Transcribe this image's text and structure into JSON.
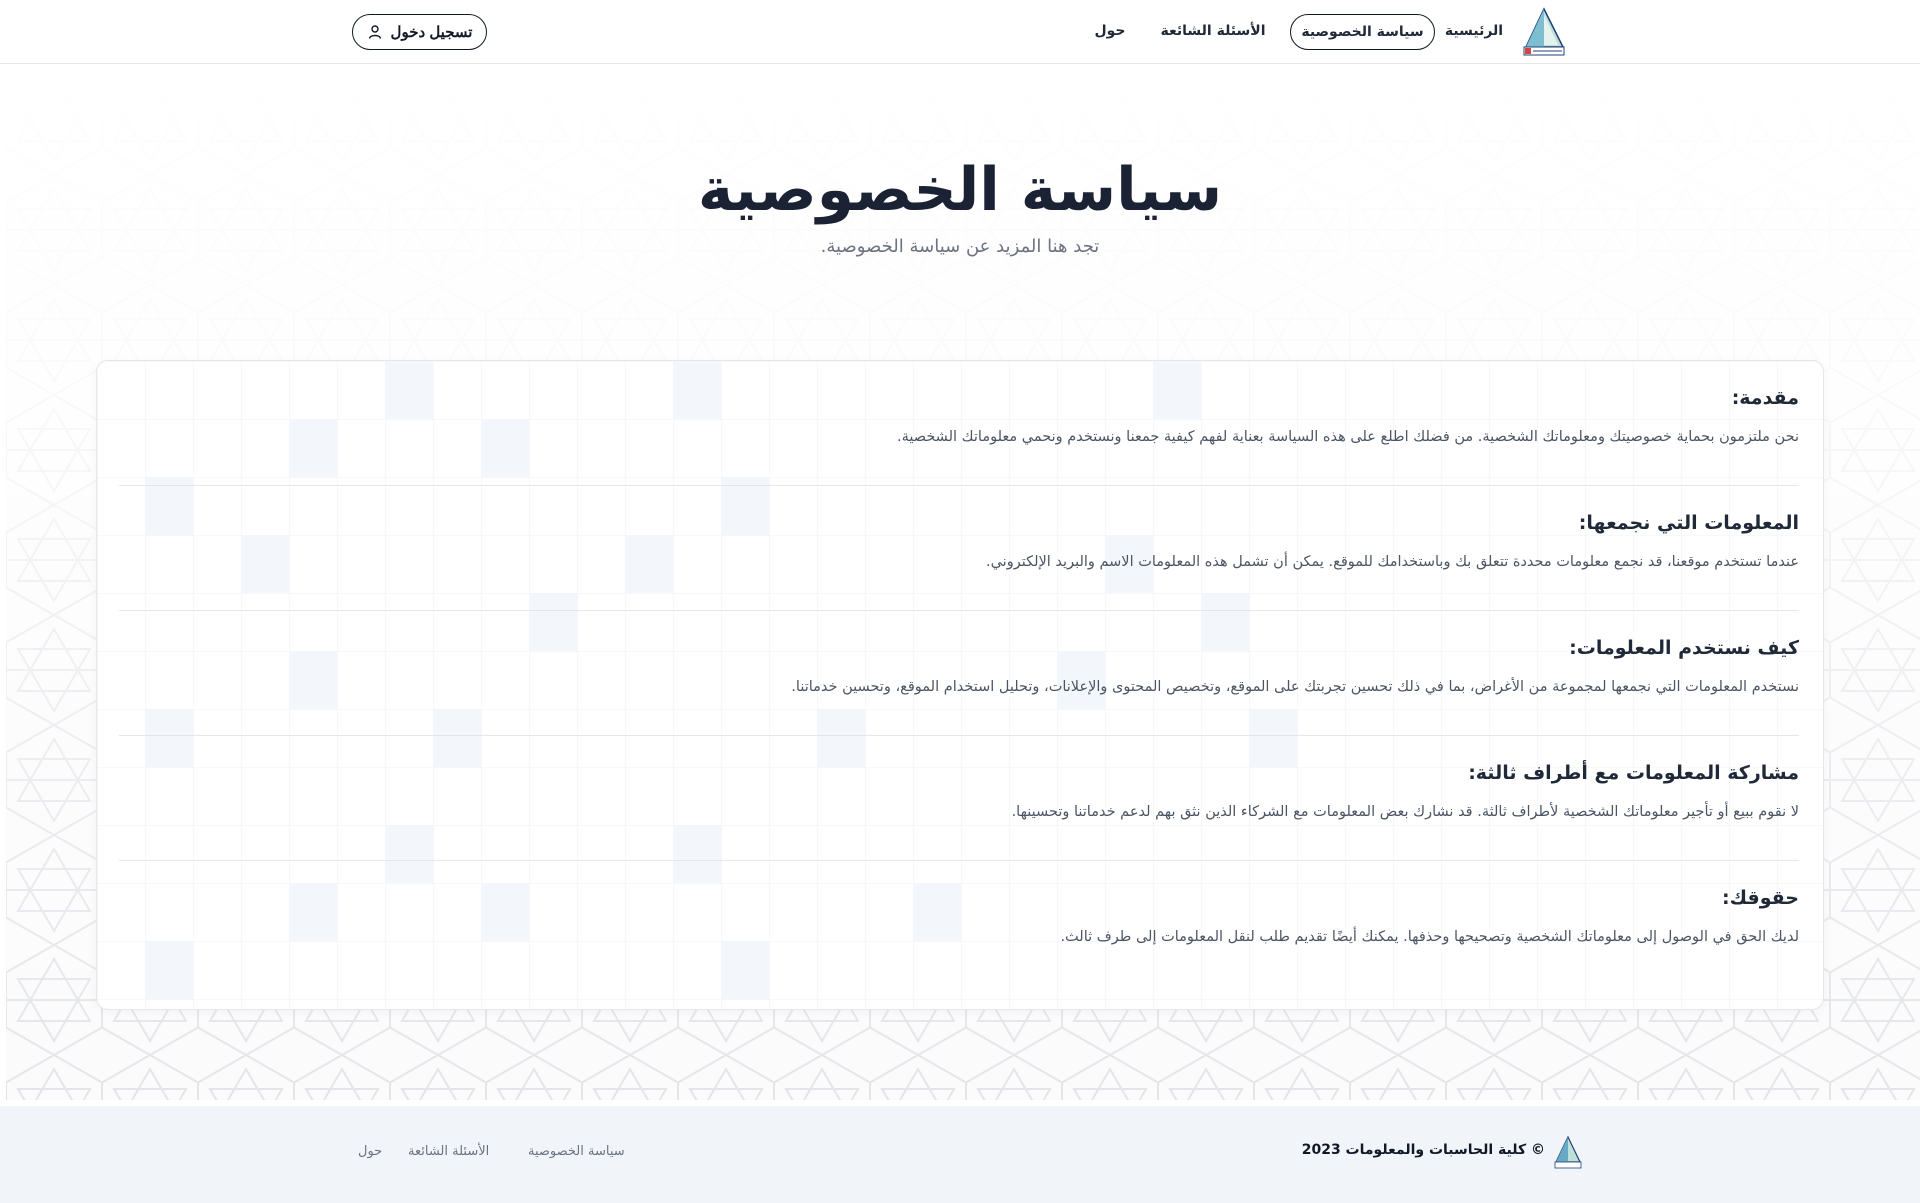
{
  "header": {
    "logo": "college-sailboat-logo",
    "nav": {
      "home": "الرئيسية",
      "privacy": "سياسة الخصوصية",
      "faq": "الأسئلة الشائعة",
      "about": "حول"
    },
    "login_label": "تسجيل دخول",
    "login_icon": "user-icon"
  },
  "hero": {
    "title": "سياسة الخصوصية",
    "subtitle": "تجد هنا المزيد عن سياسة الخصوصية."
  },
  "sections": [
    {
      "title": "مقدمة:",
      "body": "نحن ملتزمون بحماية خصوصيتك ومعلوماتك الشخصية. من فضلك اطلع على هذه السياسة بعناية لفهم كيفية جمعنا ونستخدم ونحمي معلوماتك الشخصية."
    },
    {
      "title": "المعلومات التي نجمعها:",
      "body": "عندما تستخدم موقعنا، قد نجمع معلومات محددة تتعلق بك وباستخدامك للموقع. يمكن أن تشمل هذه المعلومات الاسم والبريد الإلكتروني."
    },
    {
      "title": "كيف نستخدم المعلومات:",
      "body": "نستخدم المعلومات التي نجمعها لمجموعة من الأغراض، بما في ذلك تحسين تجربتك على الموقع، وتخصيص المحتوى والإعلانات، وتحليل استخدام الموقع، وتحسين خدماتنا."
    },
    {
      "title": "مشاركة المعلومات مع أطراف ثالثة:",
      "body": "لا نقوم ببيع أو تأجير معلوماتك الشخصية لأطراف ثالثة. قد نشارك بعض المعلومات مع الشركاء الذين نثق بهم لدعم خدماتنا وتحسينها."
    },
    {
      "title": "حقوقك:",
      "body": "لديك الحق في الوصول إلى معلوماتك الشخصية وتصحيحها وحذفها. يمكنك أيضًا تقديم طلب لنقل المعلومات إلى طرف ثالث."
    }
  ],
  "footer": {
    "copyright": "© كلية الحاسبات والمعلومات 2023",
    "links": {
      "privacy": "سياسة الخصوصية",
      "faq": "الأسئلة الشائعة",
      "about": "حول"
    }
  },
  "colors": {
    "title": "#1a2234",
    "text": "#1f2937",
    "muted": "#6b7280",
    "footer_bg": "#f1f4f9",
    "grid_tile": "#f3f6fb"
  }
}
